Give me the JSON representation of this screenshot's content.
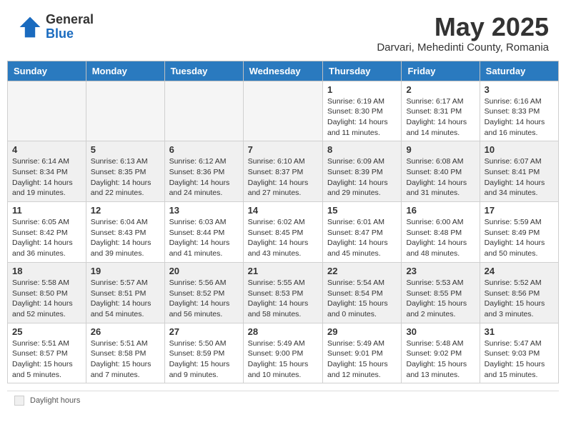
{
  "logo": {
    "general": "General",
    "blue": "Blue"
  },
  "title": "May 2025",
  "subtitle": "Darvari, Mehedinti County, Romania",
  "days_of_week": [
    "Sunday",
    "Monday",
    "Tuesday",
    "Wednesday",
    "Thursday",
    "Friday",
    "Saturday"
  ],
  "weeks": [
    [
      {
        "day": "",
        "info": "",
        "empty": true
      },
      {
        "day": "",
        "info": "",
        "empty": true
      },
      {
        "day": "",
        "info": "",
        "empty": true
      },
      {
        "day": "",
        "info": "",
        "empty": true
      },
      {
        "day": "1",
        "info": "Sunrise: 6:19 AM\nSunset: 8:30 PM\nDaylight: 14 hours\nand 11 minutes."
      },
      {
        "day": "2",
        "info": "Sunrise: 6:17 AM\nSunset: 8:31 PM\nDaylight: 14 hours\nand 14 minutes."
      },
      {
        "day": "3",
        "info": "Sunrise: 6:16 AM\nSunset: 8:33 PM\nDaylight: 14 hours\nand 16 minutes."
      }
    ],
    [
      {
        "day": "4",
        "info": "Sunrise: 6:14 AM\nSunset: 8:34 PM\nDaylight: 14 hours\nand 19 minutes."
      },
      {
        "day": "5",
        "info": "Sunrise: 6:13 AM\nSunset: 8:35 PM\nDaylight: 14 hours\nand 22 minutes."
      },
      {
        "day": "6",
        "info": "Sunrise: 6:12 AM\nSunset: 8:36 PM\nDaylight: 14 hours\nand 24 minutes."
      },
      {
        "day": "7",
        "info": "Sunrise: 6:10 AM\nSunset: 8:37 PM\nDaylight: 14 hours\nand 27 minutes."
      },
      {
        "day": "8",
        "info": "Sunrise: 6:09 AM\nSunset: 8:39 PM\nDaylight: 14 hours\nand 29 minutes."
      },
      {
        "day": "9",
        "info": "Sunrise: 6:08 AM\nSunset: 8:40 PM\nDaylight: 14 hours\nand 31 minutes."
      },
      {
        "day": "10",
        "info": "Sunrise: 6:07 AM\nSunset: 8:41 PM\nDaylight: 14 hours\nand 34 minutes."
      }
    ],
    [
      {
        "day": "11",
        "info": "Sunrise: 6:05 AM\nSunset: 8:42 PM\nDaylight: 14 hours\nand 36 minutes."
      },
      {
        "day": "12",
        "info": "Sunrise: 6:04 AM\nSunset: 8:43 PM\nDaylight: 14 hours\nand 39 minutes."
      },
      {
        "day": "13",
        "info": "Sunrise: 6:03 AM\nSunset: 8:44 PM\nDaylight: 14 hours\nand 41 minutes."
      },
      {
        "day": "14",
        "info": "Sunrise: 6:02 AM\nSunset: 8:45 PM\nDaylight: 14 hours\nand 43 minutes."
      },
      {
        "day": "15",
        "info": "Sunrise: 6:01 AM\nSunset: 8:47 PM\nDaylight: 14 hours\nand 45 minutes."
      },
      {
        "day": "16",
        "info": "Sunrise: 6:00 AM\nSunset: 8:48 PM\nDaylight: 14 hours\nand 48 minutes."
      },
      {
        "day": "17",
        "info": "Sunrise: 5:59 AM\nSunset: 8:49 PM\nDaylight: 14 hours\nand 50 minutes."
      }
    ],
    [
      {
        "day": "18",
        "info": "Sunrise: 5:58 AM\nSunset: 8:50 PM\nDaylight: 14 hours\nand 52 minutes."
      },
      {
        "day": "19",
        "info": "Sunrise: 5:57 AM\nSunset: 8:51 PM\nDaylight: 14 hours\nand 54 minutes."
      },
      {
        "day": "20",
        "info": "Sunrise: 5:56 AM\nSunset: 8:52 PM\nDaylight: 14 hours\nand 56 minutes."
      },
      {
        "day": "21",
        "info": "Sunrise: 5:55 AM\nSunset: 8:53 PM\nDaylight: 14 hours\nand 58 minutes."
      },
      {
        "day": "22",
        "info": "Sunrise: 5:54 AM\nSunset: 8:54 PM\nDaylight: 15 hours\nand 0 minutes."
      },
      {
        "day": "23",
        "info": "Sunrise: 5:53 AM\nSunset: 8:55 PM\nDaylight: 15 hours\nand 2 minutes."
      },
      {
        "day": "24",
        "info": "Sunrise: 5:52 AM\nSunset: 8:56 PM\nDaylight: 15 hours\nand 3 minutes."
      }
    ],
    [
      {
        "day": "25",
        "info": "Sunrise: 5:51 AM\nSunset: 8:57 PM\nDaylight: 15 hours\nand 5 minutes."
      },
      {
        "day": "26",
        "info": "Sunrise: 5:51 AM\nSunset: 8:58 PM\nDaylight: 15 hours\nand 7 minutes."
      },
      {
        "day": "27",
        "info": "Sunrise: 5:50 AM\nSunset: 8:59 PM\nDaylight: 15 hours\nand 9 minutes."
      },
      {
        "day": "28",
        "info": "Sunrise: 5:49 AM\nSunset: 9:00 PM\nDaylight: 15 hours\nand 10 minutes."
      },
      {
        "day": "29",
        "info": "Sunrise: 5:49 AM\nSunset: 9:01 PM\nDaylight: 15 hours\nand 12 minutes."
      },
      {
        "day": "30",
        "info": "Sunrise: 5:48 AM\nSunset: 9:02 PM\nDaylight: 15 hours\nand 13 minutes."
      },
      {
        "day": "31",
        "info": "Sunrise: 5:47 AM\nSunset: 9:03 PM\nDaylight: 15 hours\nand 15 minutes."
      }
    ]
  ],
  "footer": {
    "box_label": "Daylight hours"
  }
}
